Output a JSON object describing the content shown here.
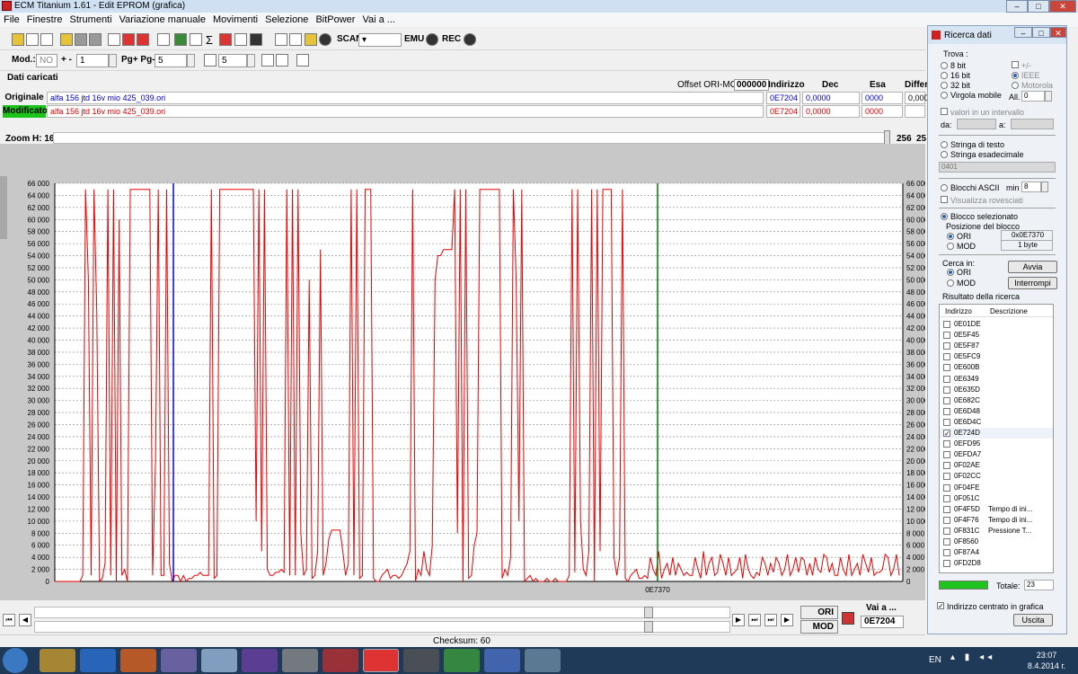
{
  "window": {
    "title": "ECM Titanium 1.61 - Edit EPROM (grafica)"
  },
  "menu": [
    "File",
    "Finestre",
    "Strumenti",
    "Variazione manuale",
    "Movimenti",
    "Selezione",
    "BitPower",
    "Vai a ..."
  ],
  "toolbar1": {
    "scan_label": "SCAN",
    "emu_label": "EMU",
    "rec_label": "REC"
  },
  "toolbar2": {
    "mod_label": "Mod.:",
    "mod_value": "NO",
    "plusminus_label": "+ -",
    "plusminus_value": "1",
    "pg_label": "Pg+ Pg-",
    "pg_value": "5",
    "p_value": "5"
  },
  "dati": {
    "title": "Dati caricati",
    "offset_label": "Offset ORI-MOD",
    "offset_value": "000000",
    "col_indirizzo": "Indirizzo",
    "col_dec": "Dec",
    "col_esa": "Esa",
    "col_diff": "Differe",
    "originale": {
      "label": "Originale",
      "file": "alfa 156 jtd 16v mio 425_039.ori",
      "addr": "0E7204",
      "dec": "0,0000",
      "esa": "0000",
      "diff": "0,0000"
    },
    "modificato": {
      "label": "Modificato",
      "file": "alfa 156 jtd 16v mio 425_039.ori",
      "addr": "0E7204",
      "dec": "0,0000",
      "esa": "0000"
    }
  },
  "zoom": {
    "label": "Zoom H: 16",
    "value_a": "256",
    "value_b": "25"
  },
  "chart_data": {
    "type": "line",
    "ylim": [
      0,
      66000
    ],
    "yticks": [
      "66 000",
      "64 000",
      "62 000",
      "60 000",
      "58 000",
      "56 000",
      "54 000",
      "52 000",
      "50 000",
      "48 000",
      "46 000",
      "44 000",
      "42 000",
      "40 000",
      "38 000",
      "36 000",
      "34 000",
      "32 000",
      "30 000",
      "28 000",
      "26 000",
      "24 000",
      "22 000",
      "20 000",
      "18 000",
      "16 000",
      "14 000",
      "12 000",
      "10 000",
      "8 000",
      "6 000",
      "4 000",
      "2 000",
      "0"
    ],
    "cursor_label": "0E7370",
    "cursor_ori_color": "#0000ff",
    "cursor_mod_color": "#007a00",
    "series_color": "#ee0000",
    "values": [
      0,
      0,
      0,
      0,
      0,
      0,
      0,
      0,
      0,
      0,
      1000,
      65000,
      50000,
      1000,
      65000,
      45000,
      0,
      500,
      3000,
      65000,
      1000,
      65000,
      0,
      60000,
      1000,
      2000,
      0,
      65000,
      65000,
      65000,
      65000,
      65000,
      65000,
      65000,
      65000,
      1000,
      20000,
      65000,
      1000,
      1000,
      65000,
      3000,
      0,
      1000,
      1000,
      0,
      1000,
      0,
      500,
      500,
      1000,
      1000,
      1500,
      1000,
      1000,
      1000,
      65000,
      500,
      1000,
      65000,
      65000,
      65000,
      65000,
      65000,
      65000,
      65000,
      65000,
      65000,
      65000,
      65000,
      65000,
      65000,
      10000,
      65000,
      5000,
      65000,
      2000,
      1000,
      1000,
      1500,
      1500,
      2000,
      1500,
      65000,
      1000,
      65000,
      1000,
      65000,
      8000,
      1000,
      2000,
      50000,
      500,
      1000,
      5000,
      55000,
      1000,
      3000,
      7000,
      8500,
      8500,
      8500,
      8500,
      5000,
      1000,
      3000,
      65000,
      1000,
      65000,
      500,
      1000,
      65000,
      65000,
      65000,
      500,
      0,
      0,
      1000,
      1500,
      2000,
      500,
      1000,
      1000,
      500,
      1000,
      2000,
      3000,
      5000,
      65000,
      0,
      2000,
      1000,
      5000,
      2000,
      1000,
      6000,
      50000,
      54000,
      54000,
      55000,
      55000,
      55000,
      55000,
      65000,
      8000,
      65000,
      0,
      65000,
      500,
      1000,
      6000,
      8000,
      65000,
      65000,
      65000,
      65000,
      65000,
      65000,
      65000,
      65000,
      500,
      2000,
      1000,
      4000,
      65000,
      50000,
      10000,
      65000,
      0,
      500,
      1000,
      0,
      500,
      0,
      0,
      0,
      500,
      0,
      0,
      500,
      0,
      0,
      0,
      0,
      1000,
      65000,
      1500,
      65000,
      10000,
      2000,
      1000,
      5000,
      65000,
      0,
      65000,
      5000,
      65000,
      65000,
      65000,
      65000,
      4000,
      1000,
      4000,
      65000,
      500,
      0,
      1000,
      1500,
      2000,
      500,
      500,
      1000,
      500,
      4000,
      2000,
      1000,
      5000,
      500,
      2000,
      3000,
      1000,
      4000,
      1000,
      3000,
      2000,
      1000,
      1500,
      1000,
      1000,
      4000,
      2000,
      500,
      5000,
      1000,
      3000,
      4000,
      1000,
      1500,
      4500,
      3000,
      1000,
      4000,
      1000,
      1500,
      2000,
      4000,
      500,
      4500,
      2000,
      1000,
      500,
      1500,
      1000,
      4000,
      3000,
      1000,
      3000,
      1500,
      4000,
      3000,
      1000,
      2000,
      4500,
      1000,
      2000,
      4000,
      1500,
      4000,
      3500,
      1000,
      3000,
      1000,
      4000,
      2000,
      1500,
      4500,
      4000,
      1500,
      3000,
      1000,
      1000,
      4000,
      2000,
      1000,
      4500,
      1000,
      2000,
      3000,
      1000,
      4500,
      3000,
      1500,
      4000,
      1000,
      1500,
      1500,
      2000,
      4500,
      4000,
      1000,
      2000,
      4500,
      1000
    ]
  },
  "bottom": {
    "vai_label": "Vai a ...",
    "vai_value": "0E7204",
    "ori_btn": "ORI",
    "mod_btn": "MOD"
  },
  "status": {
    "checksum": "Checksum: 60"
  },
  "dialog": {
    "title": "Ricerca dati",
    "trova": "Trova :",
    "r8": "8 bit",
    "r16": "16 bit",
    "r32": "32 bit",
    "rvirgola": "Virgola mobile",
    "pm": "+/-",
    "ieee": "IEEE",
    "motorola": "Motorola",
    "all_label": "All.",
    "all_value": "0",
    "intervallo": "valori in un intervallo",
    "da": "da:",
    "a": "a:",
    "stringa_testo": "Stringa di testo",
    "stringa_esa": "Stringa esadecimale",
    "stringa_value": "0401",
    "blocchi": "Blocchi ASCII",
    "min_label": "min",
    "min_value": "8",
    "visualizza": "Visualizza rovesciati",
    "blocco_sel": "Blocco selezionato",
    "posizione": "Posizione del blocco",
    "ori": "ORI",
    "ori_value": "0x0E7370",
    "mod": "MOD",
    "mod_value": "1 byte",
    "cerca_in": "Cerca in:",
    "cerca_ori": "ORI",
    "cerca_mod": "MOD",
    "avvia": "Avvia",
    "interrompi": "Interrompi",
    "risultato": "Risultato della ricerca",
    "col_addr": "Indirizzo",
    "col_desc": "Descrizione",
    "results": [
      {
        "a": "0E01DE",
        "d": "",
        "c": false
      },
      {
        "a": "0E5F45",
        "d": "",
        "c": false
      },
      {
        "a": "0E5F87",
        "d": "",
        "c": false
      },
      {
        "a": "0E5FC9",
        "d": "",
        "c": false
      },
      {
        "a": "0E600B",
        "d": "",
        "c": false
      },
      {
        "a": "0E6349",
        "d": "",
        "c": false
      },
      {
        "a": "0E635D",
        "d": "",
        "c": false
      },
      {
        "a": "0E682C",
        "d": "",
        "c": false
      },
      {
        "a": "0E6D48",
        "d": "",
        "c": false
      },
      {
        "a": "0E6D4C",
        "d": "",
        "c": false
      },
      {
        "a": "0E724D",
        "d": "",
        "c": true
      },
      {
        "a": "0EFD95",
        "d": "",
        "c": false
      },
      {
        "a": "0EFDA7",
        "d": "",
        "c": false
      },
      {
        "a": "0F02AE",
        "d": "",
        "c": false
      },
      {
        "a": "0F02CC",
        "d": "",
        "c": false
      },
      {
        "a": "0F04FE",
        "d": "",
        "c": false
      },
      {
        "a": "0F051C",
        "d": "",
        "c": false
      },
      {
        "a": "0F4F5D",
        "d": "Tempo di ini...",
        "c": false
      },
      {
        "a": "0F4F76",
        "d": "Tempo di ini...",
        "c": false
      },
      {
        "a": "0F831C",
        "d": "Pressione T...",
        "c": false
      },
      {
        "a": "0F8560",
        "d": "",
        "c": false
      },
      {
        "a": "0F87A4",
        "d": "",
        "c": false
      },
      {
        "a": "0FD2D8",
        "d": "",
        "c": false
      }
    ],
    "totale_label": "Totale:",
    "totale_value": "23",
    "centrato": "Indirizzo centrato in grafica",
    "uscita": "Uscita"
  },
  "taskbar": {
    "lang": "EN",
    "time": "23:07",
    "date": "8.4.2014 г."
  }
}
